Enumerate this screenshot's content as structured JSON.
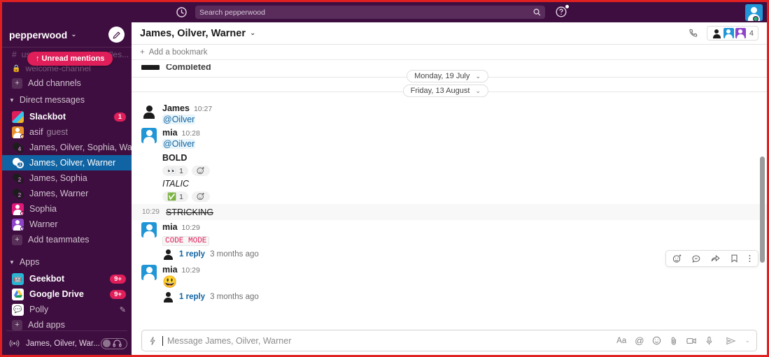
{
  "topbar": {
    "history_icon": "clock-icon",
    "search_placeholder": "Search pepperwood",
    "search_icon": "magnifier-icon",
    "help_icon": "help-icon",
    "avatar_icon": "user-avatar"
  },
  "sidebar": {
    "workspace_name": "pepperwood",
    "workspace_caret": "⌄",
    "compose_icon": "compose-icon",
    "ghost_channels": [
      {
        "label": "username-created-bundles...",
        "icon": "hash-icon"
      },
      {
        "label": "welcome-channel",
        "icon": "lock-icon"
      }
    ],
    "unread_mentions_pill": "↑  Unread mentions",
    "add_channels": "Add channels",
    "dm_section": "Direct messages",
    "dms": [
      {
        "label": "Slackbot",
        "avatar": "slackbot-avatar",
        "badge": "1",
        "bold": true,
        "selected": false
      },
      {
        "label": "asif",
        "suffix": "guest",
        "avatar": "person-avatar-orange",
        "bold": false,
        "selected": false
      },
      {
        "label": "James, Oilver, Sophia, War...",
        "avatar": "group-avatar",
        "count": "4",
        "bold": false,
        "selected": false
      },
      {
        "label": "James, Oilver, Warner",
        "avatar": "group-avatar",
        "count": "3",
        "bold": false,
        "selected": true
      },
      {
        "label": "James, Sophia",
        "avatar": "group-avatar",
        "count": "2",
        "bold": false,
        "selected": false
      },
      {
        "label": "James, Warner",
        "avatar": "group-avatar",
        "count": "2",
        "bold": false,
        "selected": false
      },
      {
        "label": "Sophia",
        "avatar": "person-avatar-pink",
        "bold": false,
        "selected": false
      },
      {
        "label": "Warner",
        "avatar": "person-avatar-purple",
        "bold": false,
        "selected": false
      }
    ],
    "add_teammates": "Add teammates",
    "apps_section": "Apps",
    "apps": [
      {
        "label": "Geekbot",
        "badge": "9+",
        "avatar": "geekbot-icon"
      },
      {
        "label": "Google Drive",
        "badge": "9+",
        "avatar": "google-drive-icon"
      },
      {
        "label": "Polly",
        "pencil": "✎",
        "avatar": "polly-icon"
      }
    ],
    "add_apps": "Add apps",
    "huddle": {
      "icon": "huddle-broadcast-icon",
      "label": "James, Oilver, War...",
      "headphones_icon": "headphones-icon"
    }
  },
  "channel": {
    "title": "James, Oilver, Warner",
    "title_caret": "⌄",
    "call_icon": "phone-icon",
    "members_count": "4",
    "bookmark_bar": "Add a bookmark",
    "bookmark_plus": "+"
  },
  "messages": {
    "partial_top": "Completed",
    "date_dividers": [
      {
        "label": "Monday, 19 July",
        "caret": "⌄"
      },
      {
        "label": "Friday, 13 August",
        "caret": "⌄"
      }
    ],
    "items": [
      {
        "author": "James",
        "time": "10:27",
        "avatar": "dark",
        "mention": "@Oilver"
      },
      {
        "author": "mia",
        "time": "10:28",
        "avatar": "blue",
        "mention": "@Oilver",
        "blocks": [
          {
            "style": "bold",
            "text": "BOLD",
            "reaction_emoji": "👀",
            "reaction_count": "1"
          },
          {
            "style": "italic",
            "text": "ITALIC",
            "reaction_emoji": "✅",
            "reaction_count": "1"
          }
        ]
      }
    ],
    "strike_row": {
      "time": "10:29",
      "text": "STRICKING"
    },
    "code_message": {
      "author": "mia",
      "time": "10:29",
      "avatar": "blue",
      "code_text": "CODE MODE",
      "thread_count": "1 reply",
      "thread_when": "3 months ago"
    },
    "emoji_message": {
      "author": "mia",
      "time": "10:29",
      "avatar": "blue",
      "emoji": "😃",
      "thread_count": "1 reply",
      "thread_when": "3 months ago"
    }
  },
  "hover_toolbar": {
    "react_icon": "emoji-react-icon",
    "thread_icon": "thread-reply-icon",
    "share_icon": "forward-icon",
    "save_icon": "bookmark-icon",
    "more_icon": "more-options-icon"
  },
  "composer": {
    "lightning_icon": "lightning-icon",
    "placeholder": "Message James, Oilver, Warner",
    "tools": [
      "format-icon",
      "mention-icon",
      "emoji-icon",
      "attach-icon",
      "video-icon",
      "mic-icon"
    ],
    "send_icon": "send-icon",
    "send_caret": "⌄"
  },
  "colors": {
    "sidebar_bg": "#3F0E40",
    "selected_row": "#1164A3",
    "badge_red": "#E01E5A",
    "link_blue": "#1264A3",
    "window_border": "#E02020"
  }
}
